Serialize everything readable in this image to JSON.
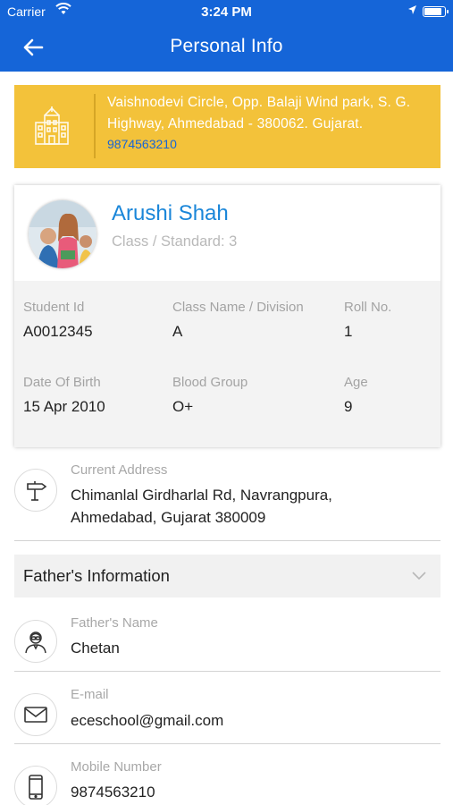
{
  "status_bar": {
    "carrier": "Carrier",
    "time": "3:24 PM",
    "battery_level": 0.9
  },
  "nav": {
    "title": "Personal Info",
    "back_icon": "arrow-left-icon"
  },
  "school": {
    "icon": "school-building-icon",
    "address": "Vaishnodevi Circle, Opp. Balaji Wind park, S. G. Highway, Ahmedabad - 380062. Gujarat.",
    "phone": "9874563210",
    "background_color": "#f3c23a"
  },
  "student": {
    "name": "Arushi Shah",
    "class_text": "Class / Standard: 3",
    "fields": [
      {
        "label": "Student Id",
        "value": "A0012345"
      },
      {
        "label": "Class Name / Division",
        "value": "A"
      },
      {
        "label": "Roll No.",
        "value": "1"
      },
      {
        "label": "Date Of Birth",
        "value": "15 Apr 2010"
      },
      {
        "label": "Blood Group",
        "value": "O+"
      },
      {
        "label": "Age",
        "value": "9"
      }
    ]
  },
  "address": {
    "icon": "signpost-icon",
    "label": "Current Address",
    "line1": "Chimanlal Girdharlal Rd, Navrangpura,",
    "line2": "Ahmedabad, Gujarat 380009"
  },
  "father_section": {
    "title": "Father's Information",
    "chevron_icon": "chevron-down-icon",
    "items": [
      {
        "icon": "person-icon",
        "label": "Father's Name",
        "value": "Chetan"
      },
      {
        "icon": "mail-icon",
        "label": "E-mail",
        "value": "eceschool@gmail.com"
      },
      {
        "icon": "mobile-phone-icon",
        "label": "Mobile Number",
        "value": "9874563210"
      }
    ]
  },
  "colors": {
    "primary": "#1565d8",
    "name_blue": "#1a86d9",
    "banner_yellow": "#f3c23a"
  }
}
